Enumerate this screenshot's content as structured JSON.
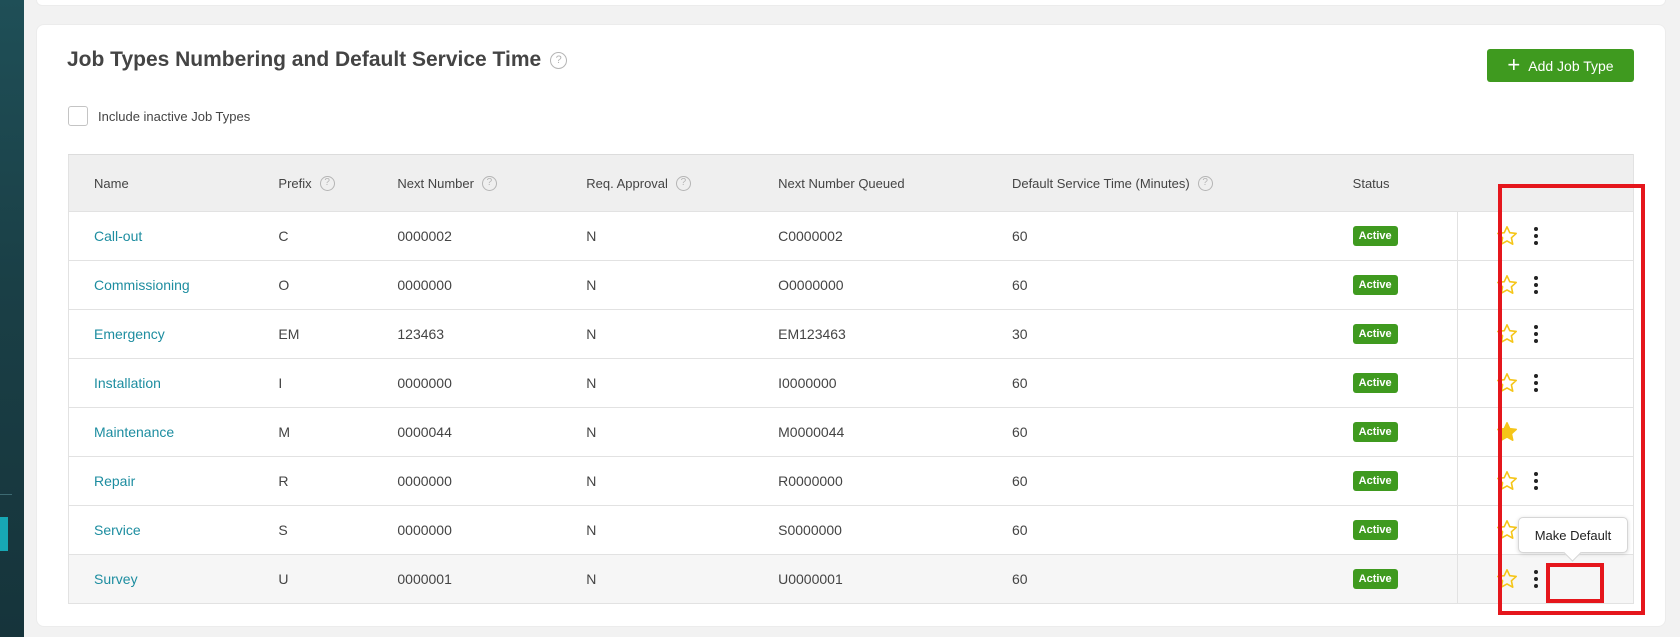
{
  "page": {
    "title": "Job Types Numbering and Default Service Time",
    "add_button_label": "Add Job Type",
    "include_inactive_label": "Include inactive Job Types",
    "include_inactive_checked": false
  },
  "table": {
    "columns": [
      {
        "label": "Name",
        "help": false
      },
      {
        "label": "Prefix",
        "help": true
      },
      {
        "label": "Next Number",
        "help": true
      },
      {
        "label": "Req. Approval",
        "help": true
      },
      {
        "label": "Next Number Queued",
        "help": false
      },
      {
        "label": "Default Service Time (Minutes)",
        "help": true
      },
      {
        "label": "Status",
        "help": false
      }
    ],
    "rows": [
      {
        "name": "Call-out",
        "prefix": "C",
        "next_number": "0000002",
        "req_approval": "N",
        "queued": "C0000002",
        "service_time": "60",
        "status": "Active",
        "is_default": false,
        "has_menu": true
      },
      {
        "name": "Commissioning",
        "prefix": "O",
        "next_number": "0000000",
        "req_approval": "N",
        "queued": "O0000000",
        "service_time": "60",
        "status": "Active",
        "is_default": false,
        "has_menu": true
      },
      {
        "name": "Emergency",
        "prefix": "EM",
        "next_number": "123463",
        "req_approval": "N",
        "queued": "EM123463",
        "service_time": "30",
        "status": "Active",
        "is_default": false,
        "has_menu": true
      },
      {
        "name": "Installation",
        "prefix": "I",
        "next_number": "0000000",
        "req_approval": "N",
        "queued": "I0000000",
        "service_time": "60",
        "status": "Active",
        "is_default": false,
        "has_menu": true
      },
      {
        "name": "Maintenance",
        "prefix": "M",
        "next_number": "0000044",
        "req_approval": "N",
        "queued": "M0000044",
        "service_time": "60",
        "status": "Active",
        "is_default": true,
        "has_menu": false
      },
      {
        "name": "Repair",
        "prefix": "R",
        "next_number": "0000000",
        "req_approval": "N",
        "queued": "R0000000",
        "service_time": "60",
        "status": "Active",
        "is_default": false,
        "has_menu": true
      },
      {
        "name": "Service",
        "prefix": "S",
        "next_number": "0000000",
        "req_approval": "N",
        "queued": "S0000000",
        "service_time": "60",
        "status": "Active",
        "is_default": false,
        "has_menu": true
      },
      {
        "name": "Survey",
        "prefix": "U",
        "next_number": "0000001",
        "req_approval": "N",
        "queued": "U0000001",
        "service_time": "60",
        "status": "Active",
        "is_default": false,
        "has_menu": true
      }
    ]
  },
  "tooltip": {
    "text": "Make Default"
  },
  "icons": {
    "help": "question-circle-icon",
    "add": "plus-icon",
    "default": "star-icon",
    "menu": "kebab-menu-icon"
  },
  "colors": {
    "accent_green": "#3f9a1f",
    "link_teal": "#1d8da0",
    "star_yellow": "#f5c518",
    "highlight_red": "#e5161c"
  }
}
